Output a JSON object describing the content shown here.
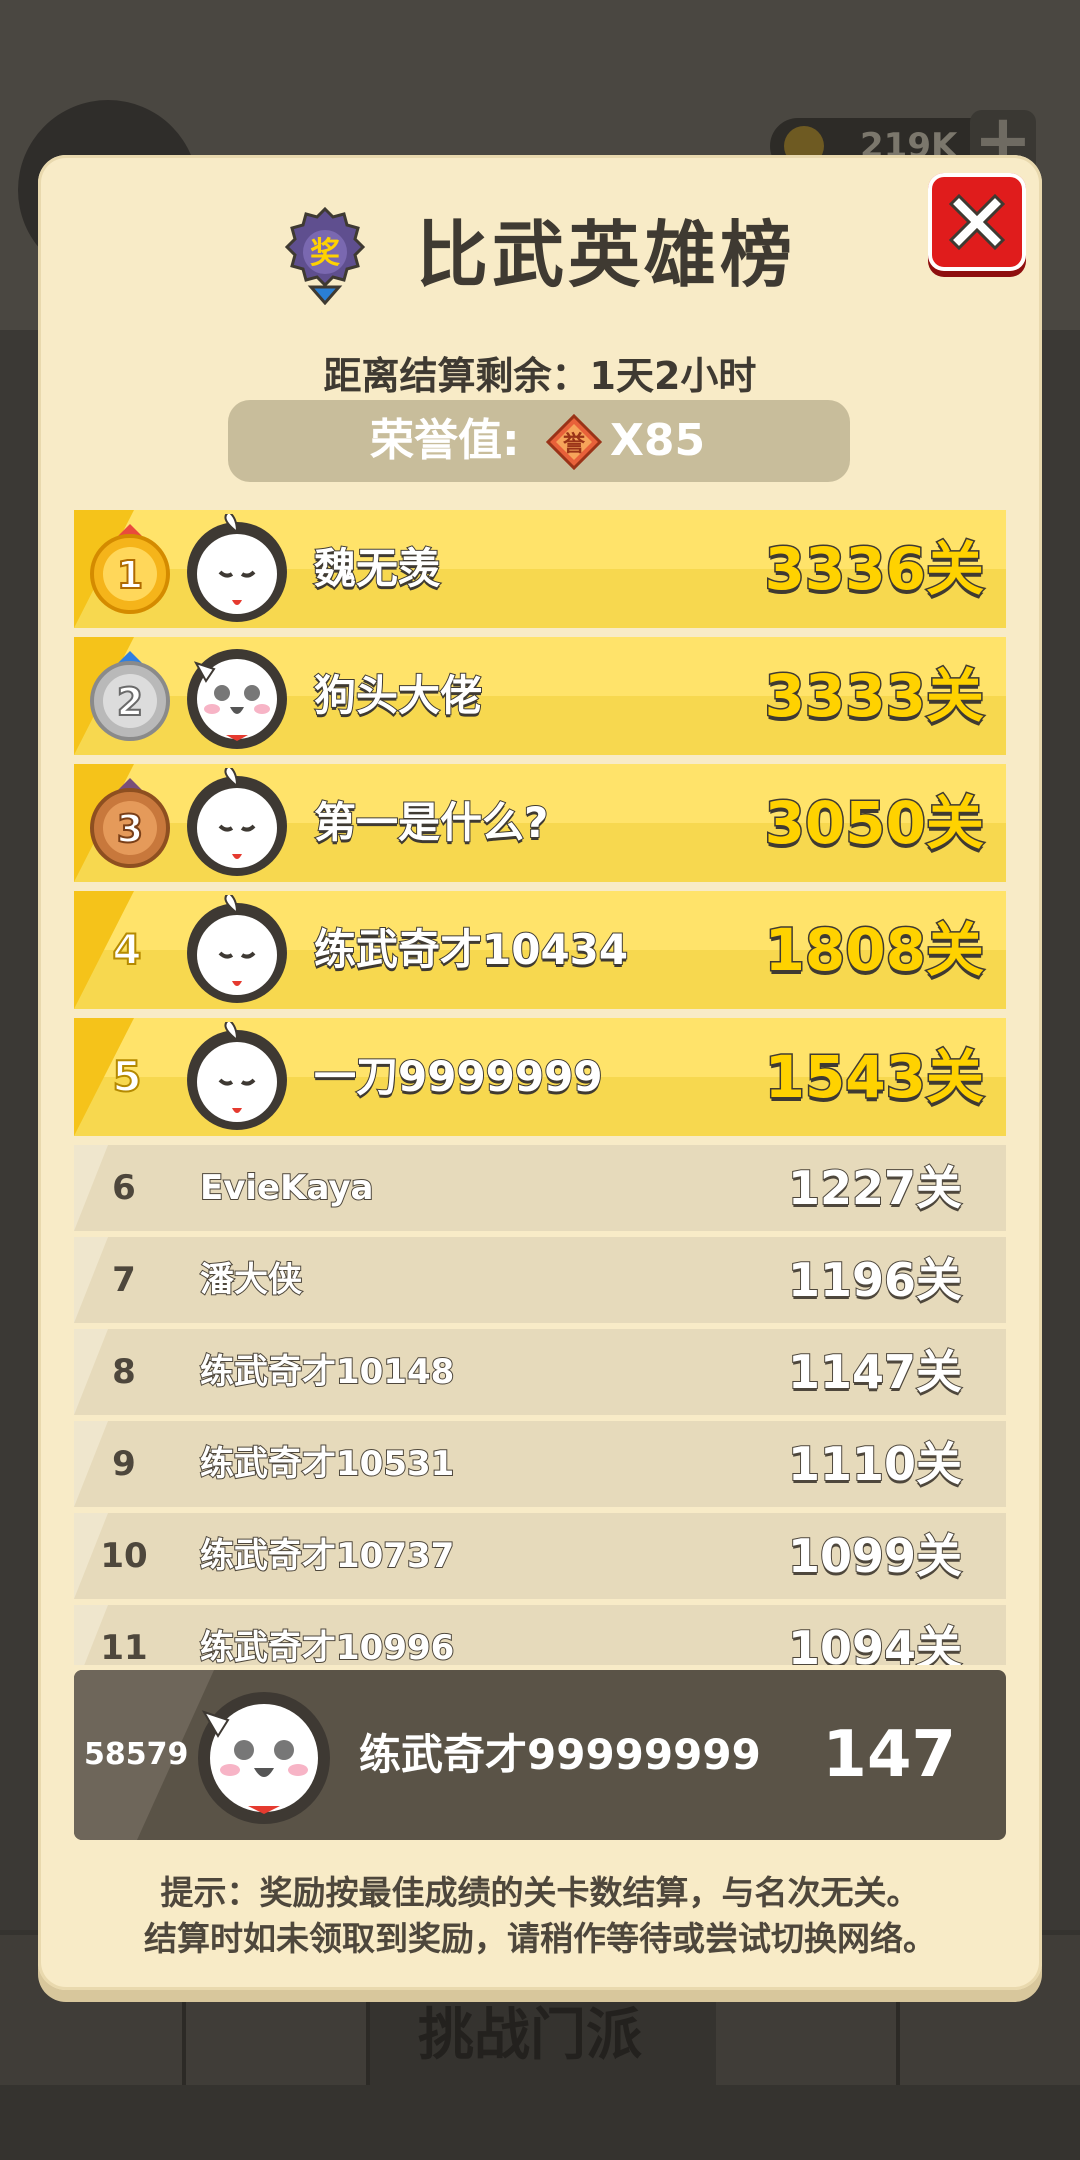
{
  "background": {
    "coin_value": "219K",
    "tab_label": "挑战门派"
  },
  "panel": {
    "title": "比武英雄榜",
    "title_icon_char": "奖",
    "countdown": "距离结算剩余：1天2小时",
    "honor_label": "荣誉值:",
    "honor_icon_char": "誉",
    "honor_value": "X85"
  },
  "top_ranks": [
    {
      "rank": "1",
      "name": "魏无羡",
      "score": "3336关",
      "medal": "gold",
      "avatar": "ghost"
    },
    {
      "rank": "2",
      "name": "狗头大佬",
      "score": "3333关",
      "medal": "silver",
      "avatar": "dog"
    },
    {
      "rank": "3",
      "name": "第一是什么?",
      "score": "3050关",
      "medal": "bronze",
      "avatar": "ghost"
    },
    {
      "rank": "4",
      "name": "练武奇才10434",
      "score": "1808关",
      "medal": "none",
      "avatar": "ghost"
    },
    {
      "rank": "5",
      "name": "一刀9999999",
      "score": "1543关",
      "medal": "none",
      "avatar": "ghost"
    }
  ],
  "ranks": [
    {
      "rank": "6",
      "name": "EvieKaya",
      "score": "1227关"
    },
    {
      "rank": "7",
      "name": "潘大侠",
      "score": "1196关"
    },
    {
      "rank": "8",
      "name": "练武奇才10148",
      "score": "1147关"
    },
    {
      "rank": "9",
      "name": "练武奇才10531",
      "score": "1110关"
    },
    {
      "rank": "10",
      "name": "练武奇才10737",
      "score": "1099关"
    },
    {
      "rank": "11",
      "name": "练武奇才10996",
      "score": "1094关"
    }
  ],
  "self": {
    "rank": "58579",
    "name": "练武奇才99999999",
    "score": "147"
  },
  "tip_line1": "提示：奖励按最佳成绩的关卡数结算，与名次无关。",
  "tip_line2": "结算时如未领取到奖励，请稍作等待或尝试切换网络。",
  "colors": {
    "panel_bg": "#f8ebc7",
    "top_row": "#ffe36a",
    "close_red": "#e01c1c",
    "score_yellow": "#ffd200"
  }
}
